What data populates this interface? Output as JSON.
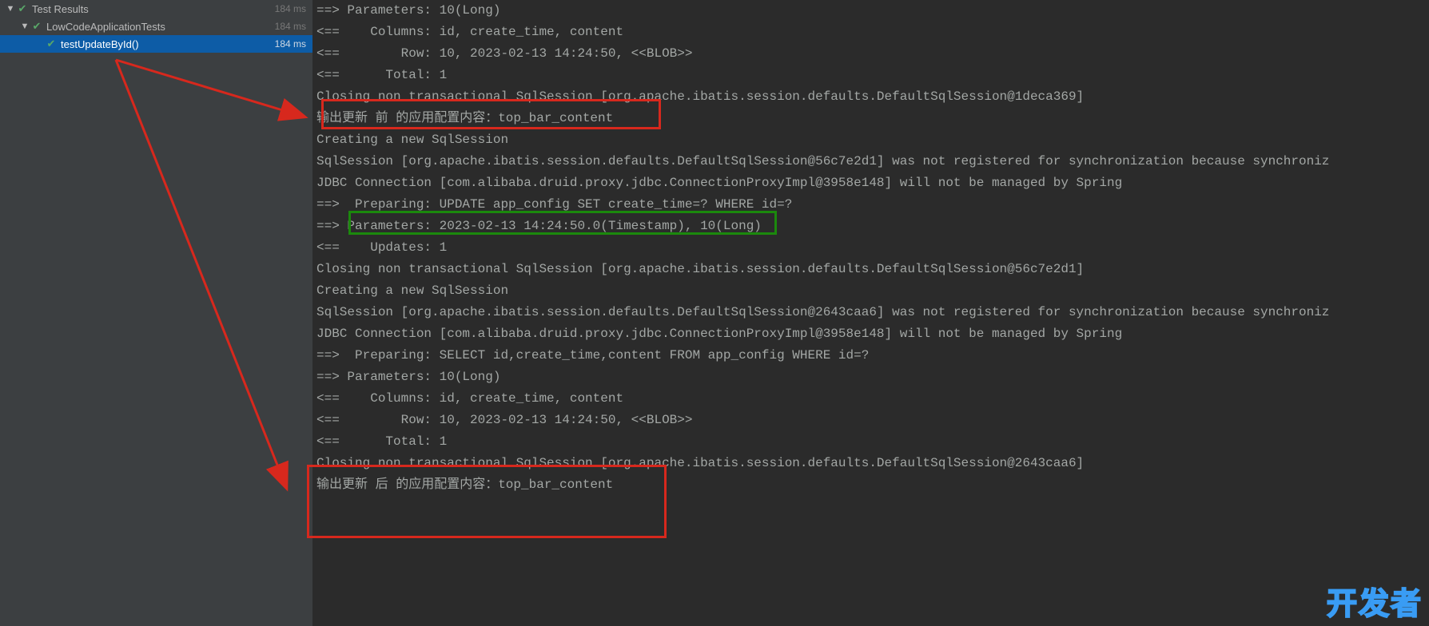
{
  "tests": {
    "root": {
      "label": "Test Results",
      "time": "184 ms"
    },
    "class": {
      "label": "LowCodeApplicationTests",
      "time": "184 ms"
    },
    "method": {
      "label": "testUpdateById()",
      "time": "184 ms"
    }
  },
  "console_lines": [
    "==> Parameters: 10(Long)",
    "<==    Columns: id, create_time, content",
    "<==        Row: 10, 2023-02-13 14:24:50, <<BLOB>>",
    "<==      Total: 1",
    "Closing non transactional SqlSession [org.apache.ibatis.session.defaults.DefaultSqlSession@1deca369]",
    "输出更新 前 的应用配置内容：top_bar_content",
    "",
    "Creating a new SqlSession",
    "SqlSession [org.apache.ibatis.session.defaults.DefaultSqlSession@56c7e2d1] was not registered for synchronization because synchroniz",
    "JDBC Connection [com.alibaba.druid.proxy.jdbc.ConnectionProxyImpl@3958e148] will not be managed by Spring",
    "==>  Preparing: UPDATE app_config SET create_time=? WHERE id=?",
    "==> Parameters: 2023-02-13 14:24:50.0(Timestamp), 10(Long)",
    "<==    Updates: 1",
    "Closing non transactional SqlSession [org.apache.ibatis.session.defaults.DefaultSqlSession@56c7e2d1]",
    "Creating a new SqlSession",
    "SqlSession [org.apache.ibatis.session.defaults.DefaultSqlSession@2643caa6] was not registered for synchronization because synchroniz",
    "JDBC Connection [com.alibaba.druid.proxy.jdbc.ConnectionProxyImpl@3958e148] will not be managed by Spring",
    "==>  Preparing: SELECT id,create_time,content FROM app_config WHERE id=?",
    "==> Parameters: 10(Long)",
    "<==    Columns: id, create_time, content",
    "<==        Row: 10, 2023-02-13 14:24:50, <<BLOB>>",
    "<==      Total: 1",
    "Closing non transactional SqlSession [org.apache.ibatis.session.defaults.DefaultSqlSession@2643caa6]",
    "输出更新 后 的应用配置内容：top_bar_content"
  ],
  "watermark": "开发者"
}
